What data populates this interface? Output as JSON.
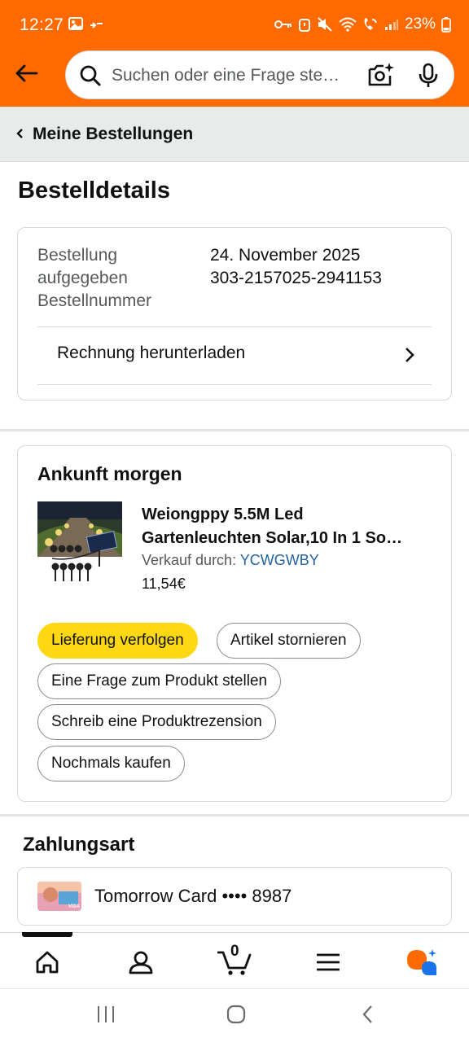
{
  "status_bar": {
    "time": "12:27",
    "battery": "23%"
  },
  "header": {
    "search_placeholder": "Suchen oder eine Frage ste…"
  },
  "breadcrumb": {
    "label": "Meine Bestellungen"
  },
  "page": {
    "title": "Bestelldetails"
  },
  "order": {
    "label_placed": "Bestellung aufgegeben",
    "label_number": "Bestellnummer",
    "date": "24. November 2025",
    "number": "303-2157025-2941153",
    "invoice_label": "Rechnung herunterladen"
  },
  "shipment": {
    "status": "Ankunft morgen",
    "product": {
      "name_line1": "Weiongppy 5.5M Led",
      "name_line2": "Gartenleuchten Solar,10 In 1 So…",
      "seller_prefix": "Verkauf durch:",
      "seller": "YCWGWBY",
      "price": "11,54€"
    },
    "actions": {
      "track": "Lieferung verfolgen",
      "cancel": "Artikel stornieren",
      "ask": "Eine Frage zum Produkt stellen",
      "review": "Schreib eine Produktrezension",
      "rebuy": "Nochmals kaufen"
    }
  },
  "payment": {
    "heading": "Zahlungsart",
    "method": "Tomorrow Card •••• 8987"
  },
  "bottom_nav": {
    "cart_count": "0",
    "items": [
      "home-icon",
      "account-icon",
      "cart-icon",
      "menu-icon",
      "assistant-icon"
    ]
  },
  "colors": {
    "header_bg": "#ff6a00",
    "primary_button": "#ffd814",
    "link": "#2162a1",
    "assistant_orange": "#ff6a00",
    "assistant_blue": "#1a73e8"
  }
}
